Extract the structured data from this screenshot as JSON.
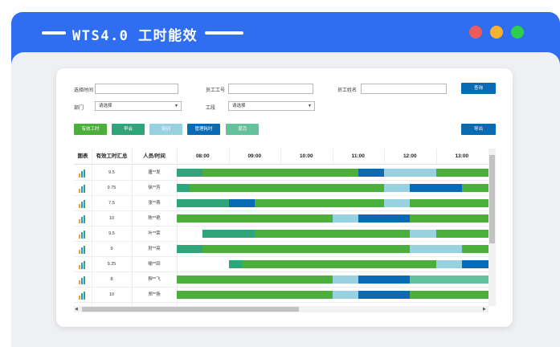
{
  "window": {
    "title": "WTS4.0 工时能效",
    "colors": {
      "titlebar": "#2f6ef0",
      "dot_red": "#ec5b5b",
      "dot_yellow": "#f6b332",
      "dot_green": "#2ccf49"
    }
  },
  "filters": {
    "time_label": "选择时间",
    "emp_id_label": "员工工号",
    "emp_name_label": "员工姓名",
    "dept_label": "部门",
    "dept_value": "请选择",
    "group_label": "工段",
    "group_value": "请选择",
    "query_button": "查询"
  },
  "toolbar": {
    "buttons": [
      {
        "label": "有效工时",
        "color": "#4caf3c"
      },
      {
        "label": "早会",
        "color": "#2ea57a"
      },
      {
        "label": "培训",
        "color": "#98d2e1"
      },
      {
        "label": "管理耗时",
        "color": "#0a6bb5"
      },
      {
        "label": "混活",
        "color": "#63c19c"
      }
    ],
    "export_button": "导出"
  },
  "table": {
    "headers": {
      "icon": "图表",
      "hours": "有效工时汇总",
      "person": "人员/时间"
    },
    "time_ticks": [
      "08:00",
      "09:00",
      "10:00",
      "11:00",
      "12:00",
      "13:00"
    ],
    "category_colors": {
      "early": "#2ea57a",
      "work": "#4caf3c",
      "train": "#98d2e1",
      "mgmt": "#0a6bb5",
      "mixed": "#63c19c"
    },
    "rows": [
      {
        "hours": "9.5",
        "name": "唐**发",
        "segments": [
          [
            "early",
            7.5,
            8.0
          ],
          [
            "work",
            8.0,
            11.0
          ],
          [
            "mgmt",
            11.0,
            11.5
          ],
          [
            "train",
            11.5,
            12.5
          ],
          [
            "work",
            12.5,
            14.2
          ]
        ]
      },
      {
        "hours": "9.75",
        "name": "徐**芳",
        "segments": [
          [
            "early",
            7.5,
            7.75
          ],
          [
            "work",
            7.75,
            11.5
          ],
          [
            "train",
            11.5,
            12.0
          ],
          [
            "mgmt",
            12.0,
            13.0
          ],
          [
            "work",
            13.0,
            14.2
          ]
        ]
      },
      {
        "hours": "7.5",
        "name": "张**燕",
        "segments": [
          [
            "early",
            7.5,
            8.5
          ],
          [
            "mgmt",
            8.5,
            9.0
          ],
          [
            "work",
            9.0,
            11.5
          ],
          [
            "train",
            11.5,
            12.0
          ],
          [
            "work",
            12.0,
            14.2
          ]
        ]
      },
      {
        "hours": "10",
        "name": "陈**艳",
        "segments": [
          [
            "work",
            7.5,
            10.5
          ],
          [
            "train",
            10.5,
            11.0
          ],
          [
            "mgmt",
            11.0,
            12.0
          ],
          [
            "work",
            12.0,
            14.2
          ]
        ]
      },
      {
        "hours": "9.5",
        "name": "叶**荣",
        "segments": [
          [
            "early",
            8.0,
            9.0
          ],
          [
            "work",
            9.0,
            12.0
          ],
          [
            "train",
            12.0,
            12.5
          ],
          [
            "work",
            12.5,
            14.2
          ]
        ]
      },
      {
        "hours": "9",
        "name": "肘**亮",
        "segments": [
          [
            "early",
            7.5,
            8.0
          ],
          [
            "work",
            8.0,
            12.0
          ],
          [
            "train",
            12.0,
            13.0
          ],
          [
            "work",
            13.0,
            14.2
          ]
        ]
      },
      {
        "hours": "9.25",
        "name": "喻**田",
        "segments": [
          [
            "early",
            8.5,
            8.75
          ],
          [
            "work",
            8.75,
            12.5
          ],
          [
            "train",
            12.5,
            13.0
          ],
          [
            "mgmt",
            13.0,
            14.2
          ]
        ]
      },
      {
        "hours": "8",
        "name": "穆**飞",
        "segments": [
          [
            "work",
            7.5,
            10.5
          ],
          [
            "train",
            10.5,
            11.0
          ],
          [
            "mgmt",
            11.0,
            12.0
          ],
          [
            "mixed",
            12.0,
            14.2
          ]
        ]
      },
      {
        "hours": "10",
        "name": "郑**扬",
        "segments": [
          [
            "work",
            7.5,
            10.5
          ],
          [
            "train",
            10.5,
            11.0
          ],
          [
            "mgmt",
            11.0,
            12.0
          ],
          [
            "work",
            12.0,
            14.2
          ]
        ]
      }
    ]
  }
}
